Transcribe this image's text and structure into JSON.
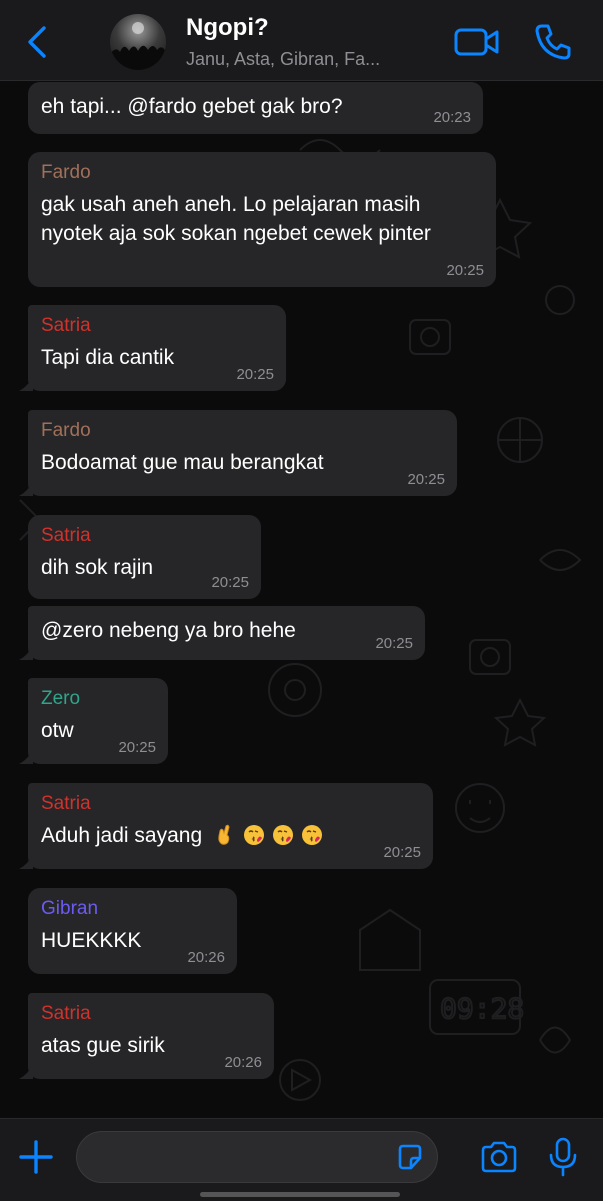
{
  "header": {
    "title": "Ngopi?",
    "members": "Janu, Asta, Gibran, Fa...",
    "accent_color": "#0a84ff"
  },
  "messages": [
    {
      "sender": "",
      "sender_color": "",
      "text": "eh tapi... @fardo gebet gak bro?",
      "time": "20:23"
    },
    {
      "sender": "Fardo",
      "sender_color": "#a0705a",
      "text": "gak usah aneh aneh. Lo pelajaran masih nyotek aja sok sokan ngebet cewek pinter",
      "time": "20:25"
    },
    {
      "sender": "Satria",
      "sender_color": "#d0322c",
      "text": "Tapi dia cantik",
      "time": "20:25"
    },
    {
      "sender": "Fardo",
      "sender_color": "#a0705a",
      "text": "Bodoamat gue mau berangkat",
      "time": "20:25"
    },
    {
      "sender": "Satria",
      "sender_color": "#d0322c",
      "text": "dih sok rajin",
      "time": "20:25"
    },
    {
      "sender": "",
      "sender_color": "",
      "text": "@zero nebeng ya bro hehe",
      "time": "20:25"
    },
    {
      "sender": "Zero",
      "sender_color": "#2fa58c",
      "text": "otw",
      "time": "20:25"
    },
    {
      "sender": "Satria",
      "sender_color": "#d0322c",
      "text": "Aduh jadi sayang",
      "emojis": [
        "crossed-fingers",
        "kissing-face",
        "kissing-face",
        "kissing-face"
      ],
      "time": "20:25"
    },
    {
      "sender": "Gibran",
      "sender_color": "#6a5cf0",
      "text": "HUEKKKK",
      "time": "20:26"
    },
    {
      "sender": "Satria",
      "sender_color": "#d0322c",
      "text": "atas gue sirik",
      "time": "20:26"
    }
  ],
  "composer": {
    "value": "",
    "icons": [
      "plus-icon",
      "sticker-icon",
      "camera-icon",
      "microphone-icon"
    ]
  },
  "colors": {
    "background": "#0b0b0c",
    "bubble": "#262628",
    "bar": "#1a1a1c",
    "accent": "#0a84ff",
    "timestamp": "#8e8e93"
  }
}
